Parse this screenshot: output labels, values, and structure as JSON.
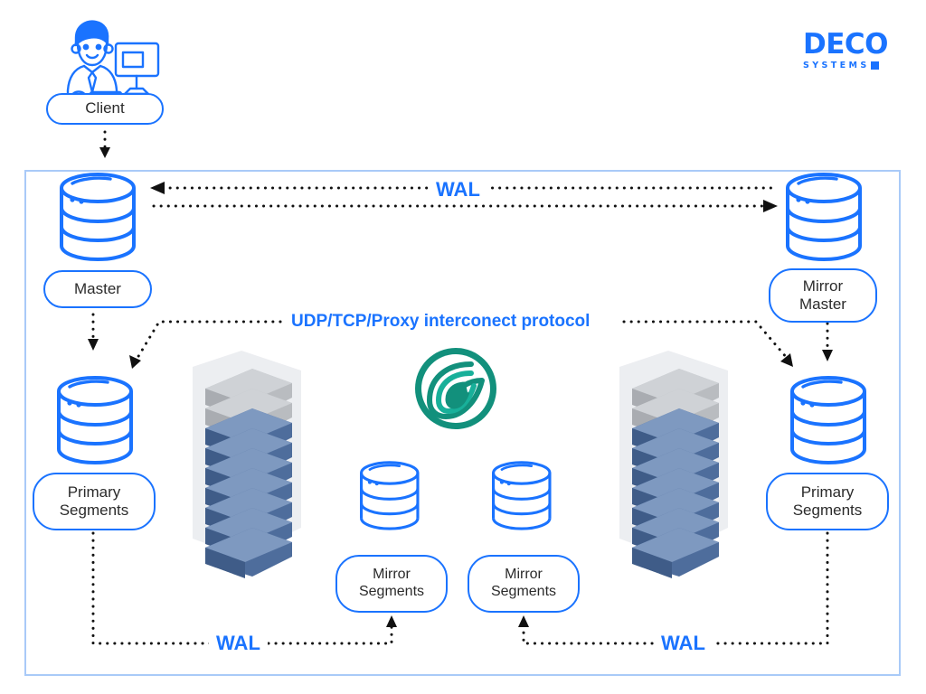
{
  "logo": {
    "name": "deco-systems-logo",
    "word": "DECO",
    "subtitle": "SYSTEMS",
    "color": "#1a73ff"
  },
  "client": {
    "icon": "person-at-computer-icon",
    "label": "Client"
  },
  "cluster": {
    "border_color": "#a9caf8",
    "center_logo": "greenplum-circle-logo",
    "center_logo_color": "#12907c",
    "nodes": [
      {
        "id": "master",
        "label": "Master",
        "icon": "database-cylinder-icon"
      },
      {
        "id": "mirror-master",
        "label": "Mirror\nMaster",
        "line1": "Mirror",
        "line2": "Master",
        "icon": "database-cylinder-icon"
      },
      {
        "id": "primary-left",
        "label": "Primary\nSegments",
        "line1": "Primary",
        "line2": "Segments",
        "icon": "database-cylinder-icon"
      },
      {
        "id": "primary-right",
        "label": "Primary\nSegments",
        "line1": "Primary",
        "line2": "Segments",
        "icon": "database-cylinder-icon"
      },
      {
        "id": "mirror-seg-left",
        "label": "Mirror\nSegments",
        "line1": "Mirror",
        "line2": "Segments",
        "icon": "database-cylinder-icon"
      },
      {
        "id": "mirror-seg-right",
        "label": "Mirror\nSegments",
        "line1": "Mirror",
        "line2": "Segments",
        "icon": "database-cylinder-icon"
      }
    ],
    "racks": [
      {
        "id": "rack-left",
        "icon": "server-rack-icon"
      },
      {
        "id": "rack-right",
        "icon": "server-rack-icon"
      }
    ],
    "connections": {
      "wal_top": "WAL",
      "interconnect": "UDP/TCP/Proxy interconect protocol",
      "wal_bottom_left": "WAL",
      "wal_bottom_right": "WAL"
    }
  },
  "colors": {
    "brand_blue": "#1a73ff",
    "frame_blue": "#a9caf8",
    "teal": "#12907c",
    "line_black": "#111111",
    "rack_blue": "#5b79a8",
    "rack_gray": "#9a9da2"
  }
}
